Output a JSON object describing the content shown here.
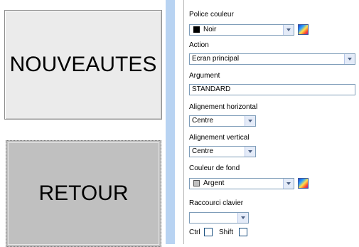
{
  "canvas": {
    "button_nouveautes": "NOUVEAUTES",
    "button_retour": "RETOUR"
  },
  "properties": {
    "font_color": {
      "label": "Police couleur",
      "value": "Noir",
      "swatch": "#000000"
    },
    "action": {
      "label": "Action",
      "value": "Ecran principal"
    },
    "argument": {
      "label": "Argument",
      "value": "STANDARD"
    },
    "h_align": {
      "label": "Alignement horizontal",
      "value": "Centre"
    },
    "v_align": {
      "label": "Alignement vertical",
      "value": "Centre"
    },
    "bg_color": {
      "label": "Couleur de fond",
      "value": "Argent",
      "swatch": "#c0c0c0"
    },
    "shortcut": {
      "label": "Raccourci clavier",
      "value": ""
    },
    "ctrl_label": "Ctrl",
    "shift_label": "Shift"
  },
  "colors": {
    "canvas_strip": "#b8d3f2",
    "input_border": "#7f9db9"
  },
  "icons": [
    "dropdown-arrow-icon",
    "color-palette-icon"
  ]
}
